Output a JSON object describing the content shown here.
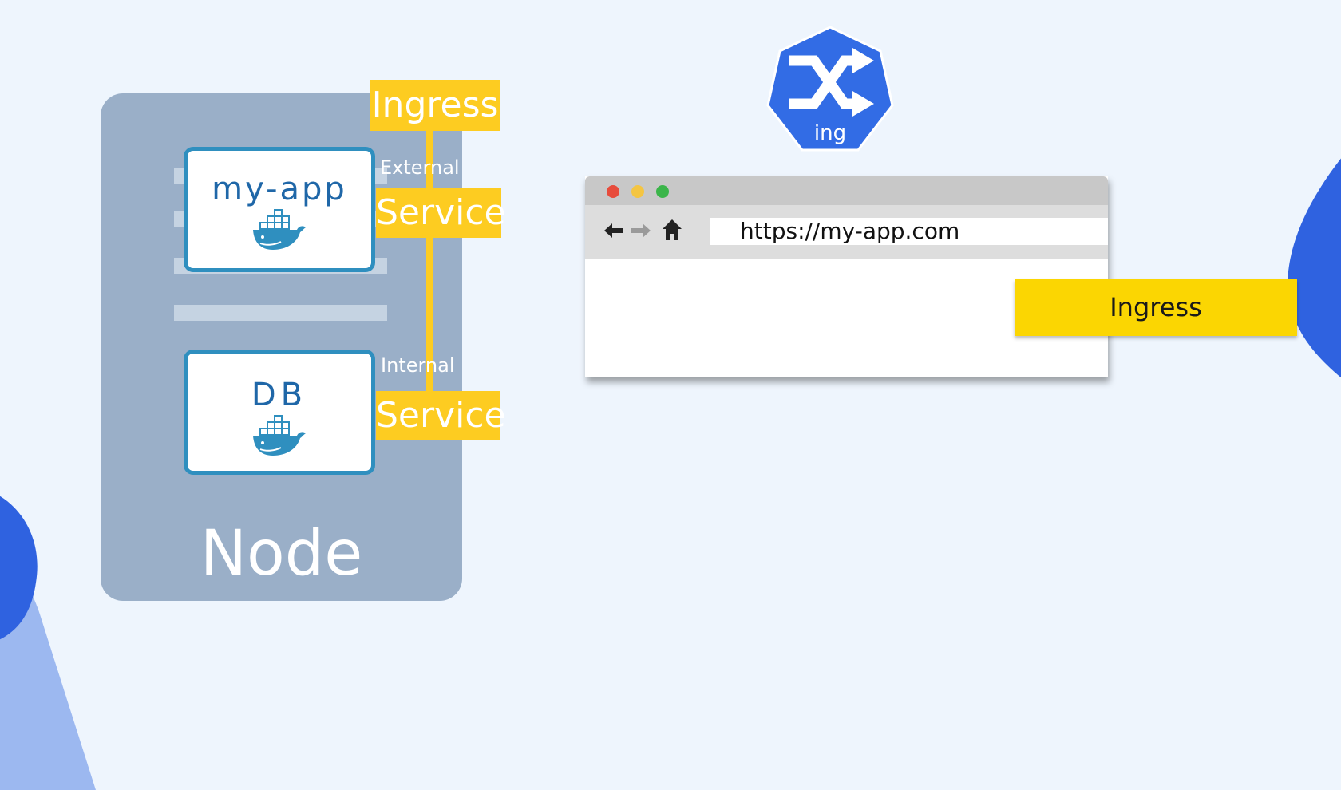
{
  "node": {
    "label": "Node",
    "pods": [
      {
        "name": "my-app"
      },
      {
        "name": "DB"
      }
    ]
  },
  "labels": {
    "ingress": "Ingress",
    "external": "External",
    "external_service": "Service",
    "internal": "Internal",
    "internal_service": "Service"
  },
  "ingress_icon": {
    "text": "ing",
    "icon": "ingress-shuffle-icon"
  },
  "browser": {
    "url": "https://my-app.com",
    "window_dots": [
      "#e74c3c",
      "#f4c542",
      "#3bb54a"
    ]
  },
  "ingress_tag": "Ingress",
  "colors": {
    "node": "#9aafc8",
    "pod_border": "#2f8fbf",
    "label_yellow": "#fdcc21",
    "ingress_tag": "#fbd602",
    "k8s_blue": "#326ce5"
  }
}
